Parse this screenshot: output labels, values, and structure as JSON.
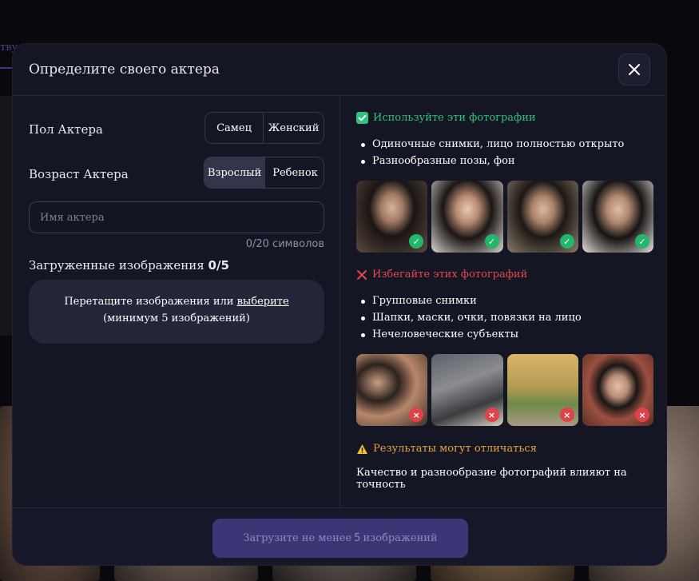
{
  "background": {
    "tab_fragment": "тву"
  },
  "modal": {
    "title": "Определите своего актера",
    "gender": {
      "label": "Пол Актера",
      "options": [
        "Самец",
        "Женский"
      ]
    },
    "age": {
      "label": "Возраст Актера",
      "options": [
        "Взрослый",
        "Ребенок"
      ],
      "selected": "Взрослый"
    },
    "name_input": {
      "placeholder": "Имя актера",
      "counter": "0/20 символов"
    },
    "uploaded": {
      "label": "Загруженные изображения",
      "count": "0/5"
    },
    "dropzone": {
      "text": "Перетащите изображения или",
      "link": "выберите",
      "hint": "(минимум 5 изображений)"
    },
    "good": {
      "title": "Используйте эти фотографии",
      "bullets": [
        "Одиночные снимки, лицо полностью открыто",
        "Разнообразные позы, фон"
      ]
    },
    "bad": {
      "title": "Избегайте этих фотографий",
      "bullets": [
        "Групповые снимки",
        "Шапки, маски, очки, повязки на лицо",
        "Нечеловеческие субъекты"
      ]
    },
    "warning": {
      "title": "Результаты могут отличаться",
      "text": "Качество и разнообразие фотографий влияют на точность"
    },
    "submit": {
      "prefix": "Загрузите не менее",
      "number": "5",
      "suffix": "изображений"
    }
  },
  "colors": {
    "good": "#2ec27e",
    "bad": "#e5484d",
    "warn": "#e8a33c",
    "accent": "#3d3676"
  }
}
